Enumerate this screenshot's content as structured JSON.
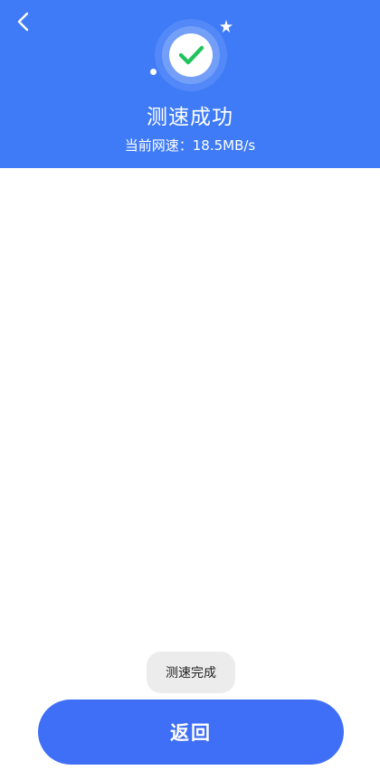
{
  "header": {
    "back_icon": "chevron-left-icon",
    "status_icon": "check-circle-icon",
    "title": "测速成功",
    "speed_text": "当前网速：18.5MB/s"
  },
  "toast": {
    "message": "测速完成"
  },
  "footer": {
    "return_label": "返回"
  },
  "colors": {
    "header_bg": "#3f7bf6",
    "button_bg": "#3f6ff6",
    "check_green": "#22c35e",
    "toast_bg": "#ececec"
  }
}
